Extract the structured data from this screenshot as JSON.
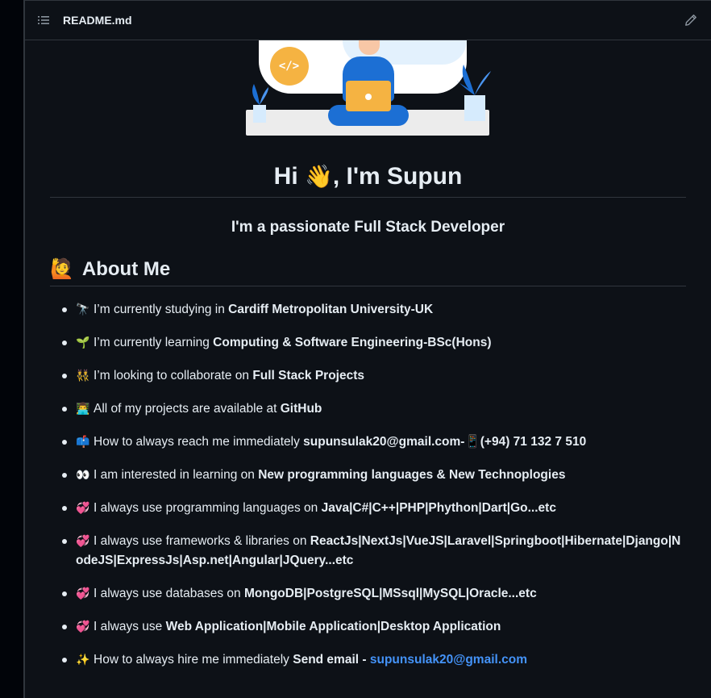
{
  "header": {
    "file_name": "README.md",
    "list_icon": "list-unordered-icon",
    "edit_icon": "pencil-icon"
  },
  "illustration": {
    "code_symbol": "</>"
  },
  "intro": {
    "greeting_before": "Hi ",
    "wave_emoji": "👋",
    "greeting_after": ", I'm Supun",
    "tagline": "I'm a passionate Full Stack Developer"
  },
  "about": {
    "emoji": "🙋",
    "heading": "About Me",
    "items": [
      {
        "icon": "🔭",
        "text": "I’m currently studying in ",
        "bold": "Cardiff Metropolitan University-UK"
      },
      {
        "icon": "🌱",
        "text": "I’m currently learning ",
        "bold": "Computing & Software Engineering-BSc(Hons)"
      },
      {
        "icon": "👯",
        "text": "I’m looking to collaborate on ",
        "bold": "Full Stack Projects"
      },
      {
        "icon": "👨‍💻",
        "text": "All of my projects are available at ",
        "bold": "GitHub"
      },
      {
        "icon": "📫",
        "text": "How to always reach me immediately ",
        "bold": "supunsulak20@gmail.com-📱(+94) 71 132 7 510"
      },
      {
        "icon": "👀",
        "text": "I am interested in learning on ",
        "bold": "New programming languages & New Technoplogies"
      },
      {
        "icon": "💞️",
        "text": "I always use programming languages on ",
        "bold": "Java|C#|C++|PHP|Phython|Dart|Go...etc"
      },
      {
        "icon": "💞️",
        "text": "I always use frameworks & libraries on ",
        "bold": "ReactJs|NextJs|VueJS|Laravel|Springboot|Hibernate|Django|NodeJS|ExpressJs|Asp.net|Angular|JQuery...etc"
      },
      {
        "icon": "💞️",
        "text": "I always use databases on ",
        "bold": "MongoDB|PostgreSQL|MSsql|MySQL|Oracle...etc"
      },
      {
        "icon": "💞️",
        "text": "I always use ",
        "bold": "Web Application|Mobile Application|Desktop Application"
      },
      {
        "icon": "✨",
        "text": "How to always hire me immediately ",
        "bold": "Send email - ",
        "link": "supunsulak20@gmail.com"
      }
    ]
  },
  "colors": {
    "background": "#0d1117",
    "text": "#e6edf3",
    "link": "#4493f8",
    "border": "#30363d"
  }
}
